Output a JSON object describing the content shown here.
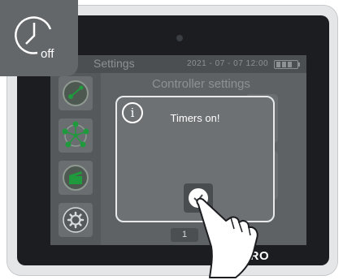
{
  "badge": {
    "icon": "timer-off-icon",
    "label": "off"
  },
  "statusbar": {
    "title": "Settings",
    "datetime": "2021 - 07 - 07  12:00",
    "battery_icon": "battery-icon"
  },
  "screen": {
    "title": "Controller settings",
    "page_number": "1",
    "sidebar": [
      "nodes-icon",
      "network-icon",
      "clapper-icon",
      "gear-icon"
    ]
  },
  "dialog": {
    "icon": "info-icon",
    "info_glyph": "i",
    "message": "Timers on!",
    "confirm_icon": "check-icon"
  },
  "brand": {
    "name": "AKRO"
  },
  "colors": {
    "screen": "#5f6265",
    "dialog_border": "#e8e9ea",
    "badge": "#64676a",
    "bezel": "#1b1d20"
  }
}
